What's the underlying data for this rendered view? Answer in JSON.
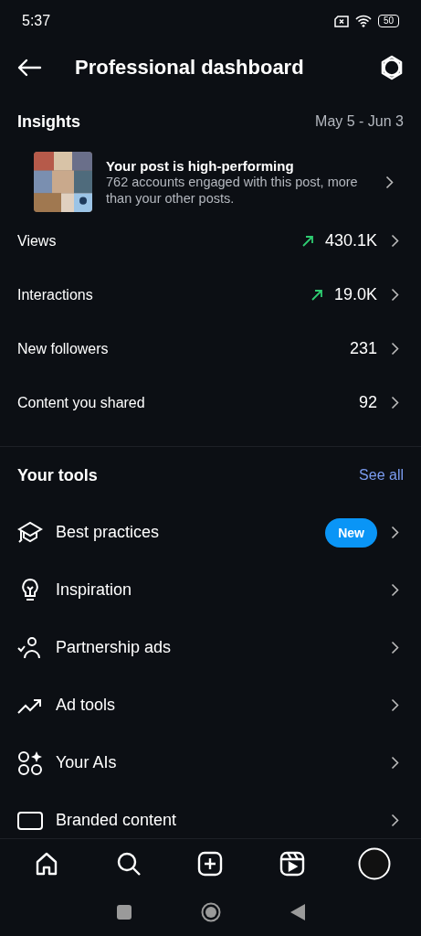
{
  "status_bar": {
    "time": "5:37",
    "battery": "50"
  },
  "header": {
    "title": "Professional dashboard"
  },
  "insights": {
    "title": "Insights",
    "date_range": "May 5 - Jun 3",
    "post": {
      "kind": "picture",
      "title": "Your post is high-performing",
      "text": "762 accounts engaged with this post, more than your other posts."
    },
    "metrics": [
      {
        "label": "Views",
        "value": "430.1K",
        "trending": true
      },
      {
        "label": "Interactions",
        "value": "19.0K",
        "trending": true
      },
      {
        "label": "New followers",
        "value": "231",
        "trending": false
      },
      {
        "label": "Content you shared",
        "value": "92",
        "trending": false
      }
    ]
  },
  "tools": {
    "title": "Your tools",
    "see_all": "See all",
    "items": [
      {
        "kind": "graduation",
        "label": "Best practices",
        "badge": "New"
      },
      {
        "kind": "bulb",
        "label": "Inspiration"
      },
      {
        "kind": "partner",
        "label": "Partnership ads"
      },
      {
        "kind": "trend",
        "label": "Ad tools"
      },
      {
        "kind": "ai",
        "label": "Your AIs"
      },
      {
        "kind": "branded",
        "label": "Branded content"
      }
    ]
  },
  "tab_bar": [
    {
      "kind": "home"
    },
    {
      "kind": "search"
    },
    {
      "kind": "create"
    },
    {
      "kind": "reels"
    },
    {
      "kind": "profile"
    }
  ]
}
